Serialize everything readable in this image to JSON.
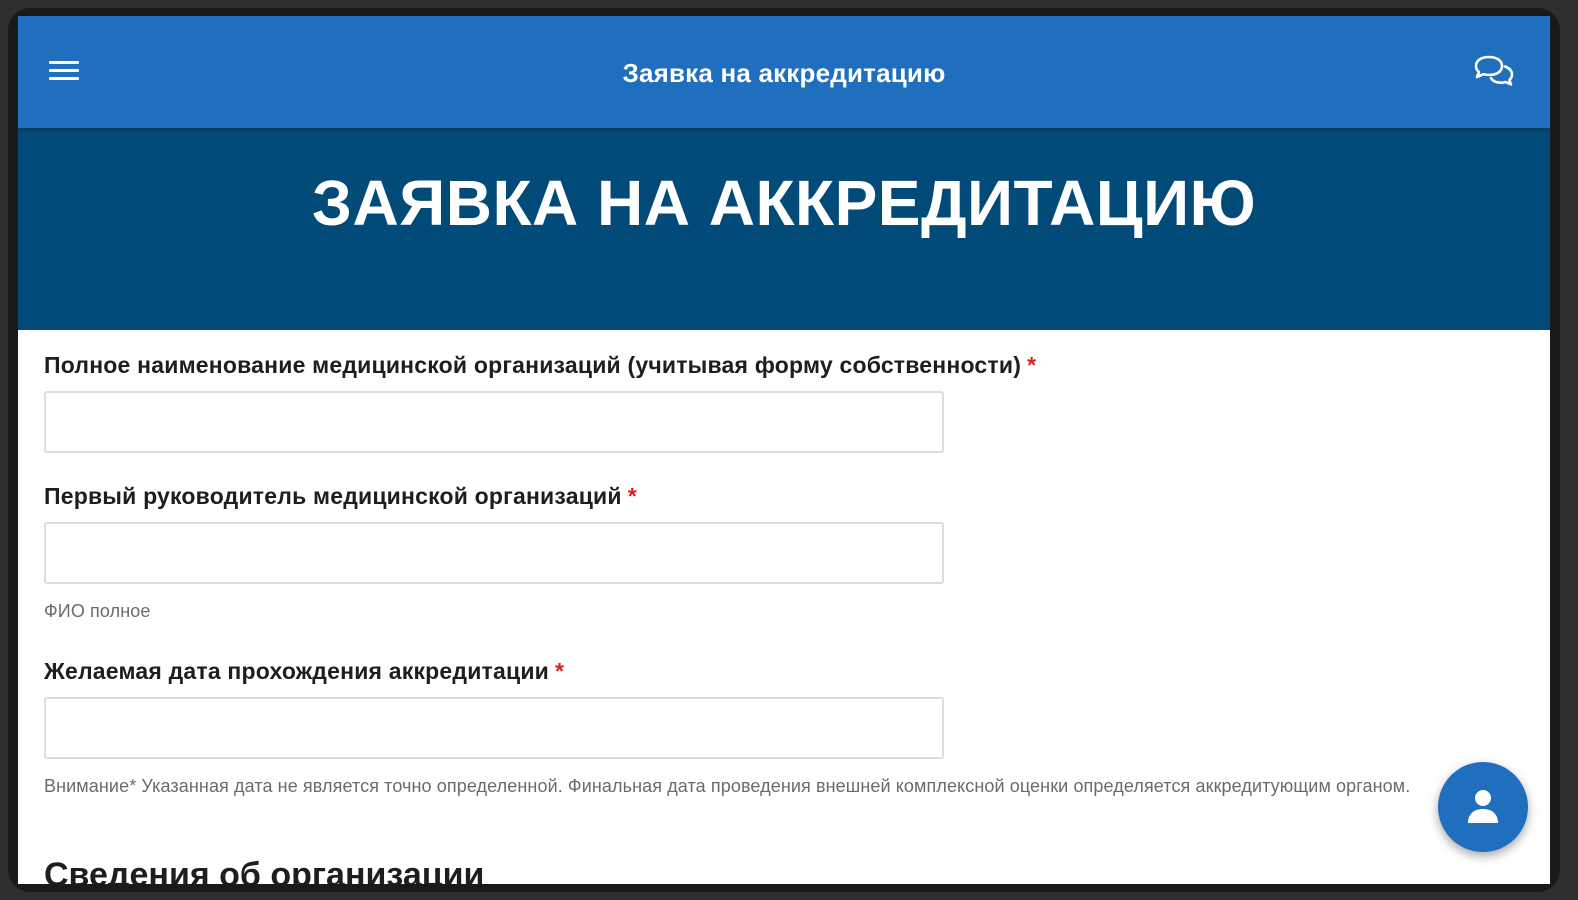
{
  "appbar": {
    "title": "Заявка на аккредитацию",
    "menu_icon": "menu-icon",
    "chat_icon": "chat-bubbles-icon"
  },
  "banner": {
    "title": "ЗАЯВКА НА АККРЕДИТАЦИЮ"
  },
  "form": {
    "fields": [
      {
        "label": "Полное наименование медицинской организаций (учитывая форму собственности)",
        "required_mark": "*",
        "value": "",
        "help": ""
      },
      {
        "label": "Первый руководитель медицинской организаций",
        "required_mark": "*",
        "value": "",
        "help": "ФИО полное"
      },
      {
        "label": "Желаемая дата прохождения аккредитации",
        "required_mark": "*",
        "value": "",
        "help": "Внимание* Указанная дата не является точно определенной. Финальная дата проведения внешней комплексной оценки определяется аккредитующим органом."
      }
    ],
    "next_section_title": "Сведения об организации"
  },
  "fab": {
    "icon": "person-icon"
  },
  "colors": {
    "appbar": "#1f6fbe",
    "banner": "#024a77",
    "required": "#e02020"
  }
}
